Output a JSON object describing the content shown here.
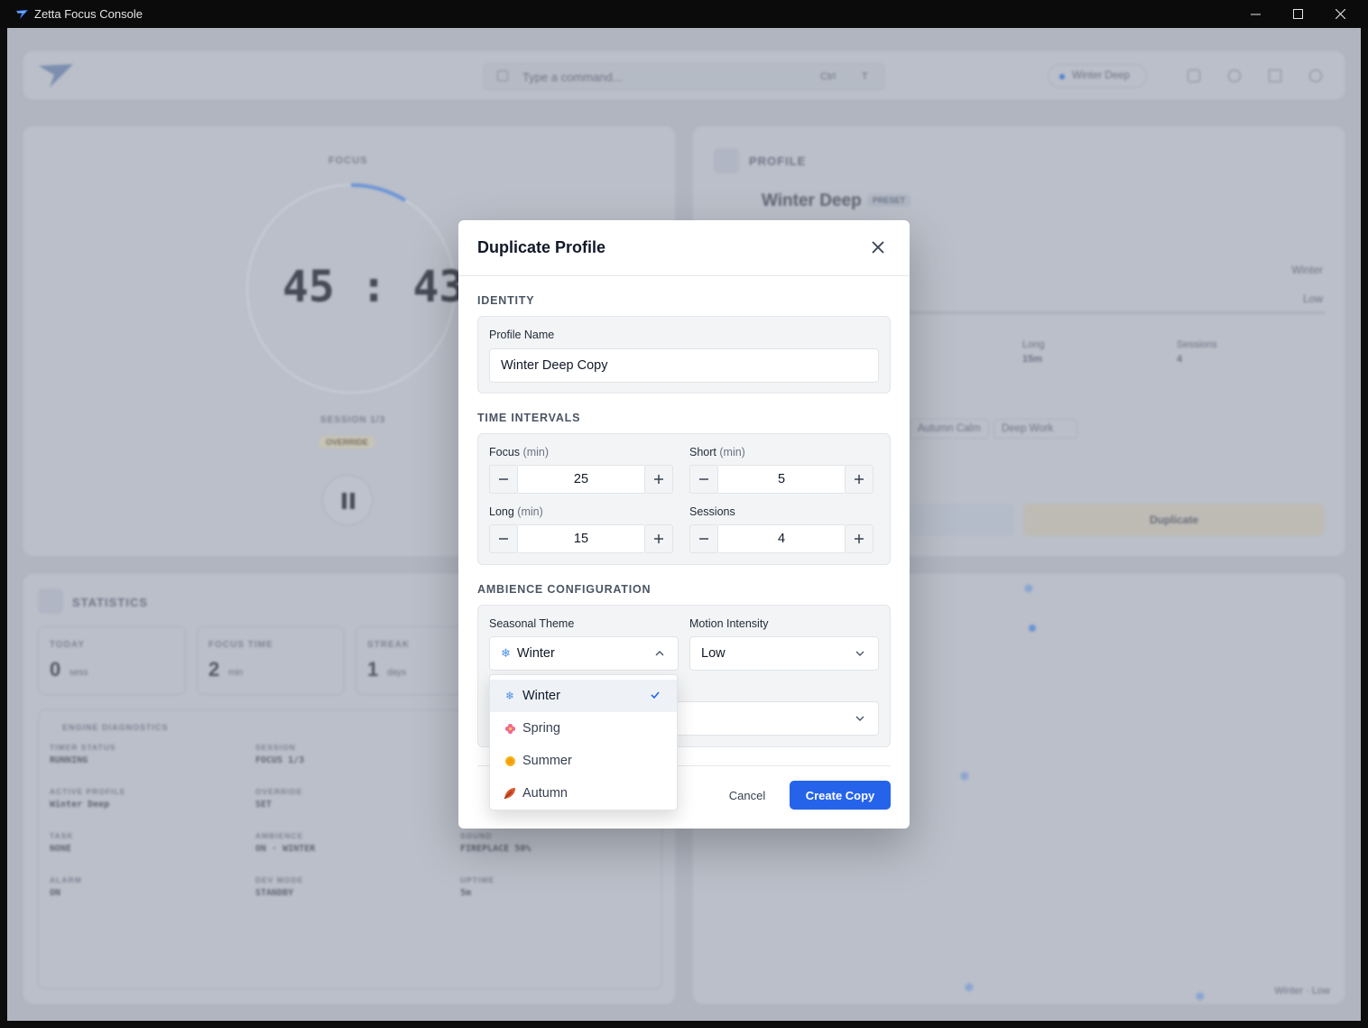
{
  "window": {
    "title": "Zetta Focus Console",
    "controls": [
      "minimize",
      "maximize",
      "close"
    ]
  },
  "background": {
    "command_placeholder": "Type a command...",
    "shortcut_keys": [
      "Ctrl",
      "T"
    ],
    "active_profile_chip": "Winter Deep",
    "timer": {
      "label": "FOCUS",
      "time": "45 : 43",
      "session": "SESSION 1/3",
      "badge": "OVERRIDE"
    },
    "profile_panel": {
      "header": "PROFILE",
      "name": "Winter Deep",
      "tag": "PRESET",
      "theme_value": "Winter",
      "motion_value": "Low",
      "stats": [
        {
          "label": "Long",
          "value": "15m"
        },
        {
          "label": "Sessions",
          "value": "4"
        }
      ],
      "chips": [
        "Autumn Calm",
        "Deep Work"
      ],
      "duplicate_button": "Duplicate"
    },
    "statistics": {
      "header": "STATISTICS",
      "tiles": [
        {
          "label": "TODAY",
          "value": "0",
          "unit": "sess"
        },
        {
          "label": "FOCUS TIME",
          "value": "2",
          "unit": "min"
        },
        {
          "label": "STREAK",
          "value": "1",
          "unit": "days"
        }
      ],
      "diagnostics_title": "ENGINE DIAGNOSTICS",
      "diagnostics": [
        {
          "k": "TIMER STATUS",
          "v": "RUNNING"
        },
        {
          "k": "SESSION",
          "v": "FOCUS 1/3"
        },
        {
          "k": "ACTIVE PROFILE",
          "v": "Winter Deep"
        },
        {
          "k": "OVERRIDE",
          "v": "SET"
        },
        {
          "k": "TASK",
          "v": "NONE"
        },
        {
          "k": "AMBIENCE",
          "v": "ON · WINTER"
        },
        {
          "k": "SOUND",
          "v": "FIREPLACE 50%"
        },
        {
          "k": "ALARM",
          "v": "ON"
        },
        {
          "k": "DEV MODE",
          "v": "STANDBY"
        },
        {
          "k": "UPTIME",
          "v": "5m"
        }
      ]
    },
    "ambience_footer": "Winter · Low"
  },
  "modal": {
    "title": "Duplicate Profile",
    "identity": {
      "section": "IDENTITY",
      "name_label": "Profile Name",
      "name_value": "Winter Deep Copy"
    },
    "intervals": {
      "section": "TIME INTERVALS",
      "focus": {
        "label": "Focus",
        "unit": "(min)",
        "value": "25"
      },
      "short": {
        "label": "Short",
        "unit": "(min)",
        "value": "5"
      },
      "long": {
        "label": "Long",
        "unit": "(min)",
        "value": "15"
      },
      "sessions": {
        "label": "Sessions",
        "value": "4"
      }
    },
    "ambience": {
      "section": "AMBIENCE CONFIGURATION",
      "theme_label": "Seasonal Theme",
      "theme_value": "Winter",
      "motion_label": "Motion Intensity",
      "motion_value": "Low",
      "theme_options": [
        {
          "label": "Winter",
          "icon": "snowflake-icon",
          "selected": true
        },
        {
          "label": "Spring",
          "icon": "blossom-icon",
          "selected": false
        },
        {
          "label": "Summer",
          "icon": "sun-icon",
          "selected": false
        },
        {
          "label": "Autumn",
          "icon": "leaf-icon",
          "selected": false
        }
      ]
    },
    "cancel_label": "Cancel",
    "create_label": "Create Copy",
    "accent": "#2563eb"
  }
}
